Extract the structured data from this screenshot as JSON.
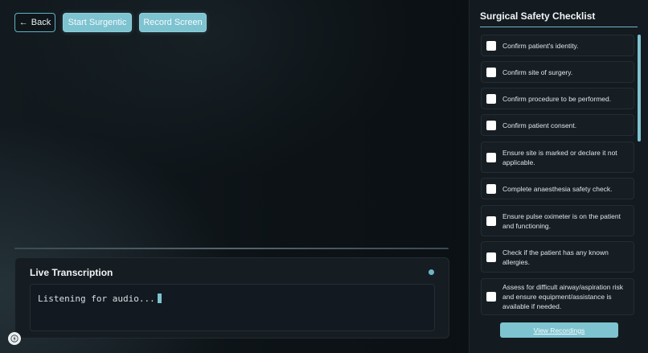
{
  "toolbar": {
    "back_label": "Back",
    "start_label": "Start Surgentic",
    "record_label": "Record Screen"
  },
  "transcription": {
    "title": "Live Transcription",
    "text": "Listening for audio..."
  },
  "checklist": {
    "title": "Surgical Safety Checklist",
    "items": [
      {
        "label": "Confirm patient's identity.",
        "checked": false
      },
      {
        "label": "Confirm site of surgery.",
        "checked": false
      },
      {
        "label": "Confirm procedure to be performed.",
        "checked": false
      },
      {
        "label": "Confirm patient consent.",
        "checked": false
      },
      {
        "label": "Ensure site is marked or declare it not applicable.",
        "checked": false
      },
      {
        "label": "Complete anaesthesia safety check.",
        "checked": false
      },
      {
        "label": "Ensure pulse oximeter is on the patient and functioning.",
        "checked": false
      },
      {
        "label": "Check if the patient has any known allergies.",
        "checked": false
      },
      {
        "label": "Assess for difficult airway/aspiration risk and ensure equipment/assistance is available if needed.",
        "checked": false
      }
    ],
    "view_recordings_label": "View Recordings"
  },
  "icons": {
    "back": "arrow-left-icon",
    "logo": "bolt-icon",
    "status": "status-dot-icon"
  },
  "colors": {
    "accent": "#7ec3d0",
    "background": "#0b1014",
    "panel": "#161d22"
  }
}
